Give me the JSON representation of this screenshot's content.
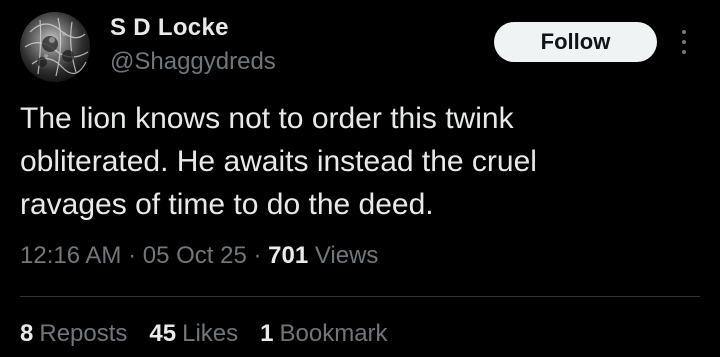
{
  "author": {
    "display_name": "S D Locke",
    "handle": "@Shaggydreds"
  },
  "follow_button": "Follow",
  "more_icon": "more-vertical-icon",
  "tweet": {
    "text": "The lion knows not to order this twink\nobliterated. He awaits instead the cruel\nravages of time to do the deed."
  },
  "meta": {
    "time": "12:16 AM",
    "sep1": " · ",
    "date": "05 Oct 25",
    "sep2": " · ",
    "views_count": "701",
    "views_label": " Views"
  },
  "stats": [
    {
      "count": "8",
      "label": "Reposts"
    },
    {
      "count": "45",
      "label": "Likes"
    },
    {
      "count": "1",
      "label": "Bookmark"
    }
  ],
  "colors": {
    "background": "#000000",
    "text_primary": "#e7e9ea",
    "text_secondary": "#71767b",
    "button_bg": "#eff3f4",
    "divider": "#2f3336"
  }
}
